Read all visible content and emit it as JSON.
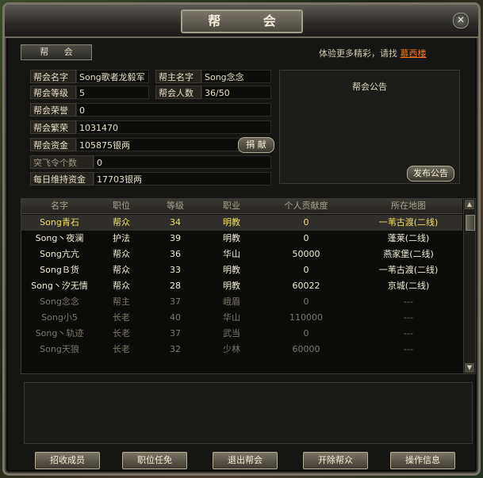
{
  "window": {
    "title": "帮 会",
    "close": "✕"
  },
  "tab": {
    "label": "帮 会"
  },
  "hint": {
    "text": "体验更多精彩，请找",
    "link": "慕西楼"
  },
  "info": {
    "guild_name_label": "帮会名字",
    "guild_name": "Song歌者龙毅军",
    "leader_label": "帮主名字",
    "leader": "Song念念",
    "level_label": "帮会等级",
    "level": "5",
    "members_label": "帮会人数",
    "members": "36/50",
    "honor_label": "帮会荣誉",
    "honor": "0",
    "prosperity_label": "帮会繁荣",
    "prosperity": "1031470",
    "funds_label": "帮会资金",
    "funds": "105875银两",
    "donate_label": "捐 献",
    "breakthrough_label": "突飞令个数",
    "breakthrough": "0",
    "upkeep_label": "每日维持资金",
    "upkeep": "17703银两"
  },
  "notice": {
    "title": "帮会公告",
    "publish_label": "发布公告"
  },
  "table": {
    "headers": [
      "名字",
      "职位",
      "等级",
      "职业",
      "个人贡献度",
      "所在地图"
    ],
    "rows": [
      {
        "name": "Song青石",
        "rank": "帮众",
        "level": "34",
        "class": "明教",
        "contrib": "0",
        "map": "一苇古渡(二线)",
        "state": "selected"
      },
      {
        "name": "Song丶夜澜",
        "rank": "护法",
        "level": "39",
        "class": "明教",
        "contrib": "0",
        "map": "蓬莱(二线)",
        "state": "online"
      },
      {
        "name": "Song亢亢",
        "rank": "帮众",
        "level": "36",
        "class": "华山",
        "contrib": "50000",
        "map": "燕家堡(二线)",
        "state": "online"
      },
      {
        "name": "SongＢ货",
        "rank": "帮众",
        "level": "33",
        "class": "明教",
        "contrib": "0",
        "map": "一苇古渡(二线)",
        "state": "online"
      },
      {
        "name": "Song丶汐无情",
        "rank": "帮众",
        "level": "28",
        "class": "明教",
        "contrib": "60022",
        "map": "京城(二线)",
        "state": "online"
      },
      {
        "name": "Song念念",
        "rank": "帮主",
        "level": "37",
        "class": "峨眉",
        "contrib": "0",
        "map": "---",
        "state": "offline"
      },
      {
        "name": "Song小5",
        "rank": "长老",
        "level": "40",
        "class": "华山",
        "contrib": "110000",
        "map": "---",
        "state": "offline"
      },
      {
        "name": "Song丶轨迹",
        "rank": "长老",
        "level": "37",
        "class": "武当",
        "contrib": "0",
        "map": "---",
        "state": "offline"
      },
      {
        "name": "Song天狼",
        "rank": "长老",
        "level": "32",
        "class": "少林",
        "contrib": "60000",
        "map": "---",
        "state": "offline"
      }
    ]
  },
  "buttons": {
    "recruit": "招收成员",
    "appoint": "职位任免",
    "leave": "退出帮会",
    "expel": "开除帮众",
    "log": "操作信息"
  },
  "colors": {
    "selected": "#f0e060",
    "online": "#f2eed8",
    "offline": "#7c776a",
    "link": "#ff7a1a"
  }
}
